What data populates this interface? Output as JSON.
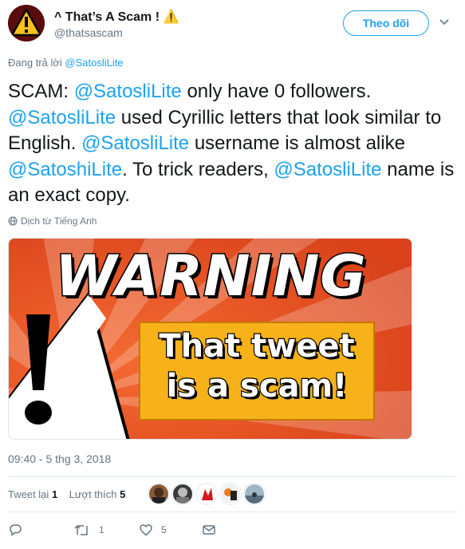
{
  "author": {
    "display_name": "^ That’s A Scam ! ⚠️",
    "handle": "@thatsascam"
  },
  "follow_button": {
    "label": "Theo dõi"
  },
  "reply_context": {
    "prefix": "Đang trả lời",
    "mention": "@SatosliLite"
  },
  "tweet": {
    "segments": [
      "SCAM: ",
      "@SatosliLite",
      " only have 0 followers. ",
      "@SatosliLite",
      " used Cyrillic letters that look similar to English. ",
      "@SatosliLite",
      " username is almost alike ",
      "@SatoshiLite",
      ". To trick readers, ",
      "@SatosliLite",
      " name is an exact copy."
    ]
  },
  "translate_link": "Dịch từ Tiếng Anh",
  "media": {
    "headline": "WARNING",
    "line1": "That tweet",
    "line2": "is a scam!"
  },
  "timestamp": "09:40 - 5 thg 3, 2018",
  "stats": {
    "retweets_label": "Tweet lại",
    "retweets_count": "1",
    "likes_label": "Lượt thích",
    "likes_count": "5"
  },
  "actions": {
    "reply_icon": "reply-icon",
    "retweet_count": "1",
    "like_count": "5"
  },
  "colors": {
    "link": "#1da1f2",
    "secondary_text": "#657786",
    "warning_orange": "#e8501d",
    "warning_yellow": "#f7b21a"
  }
}
